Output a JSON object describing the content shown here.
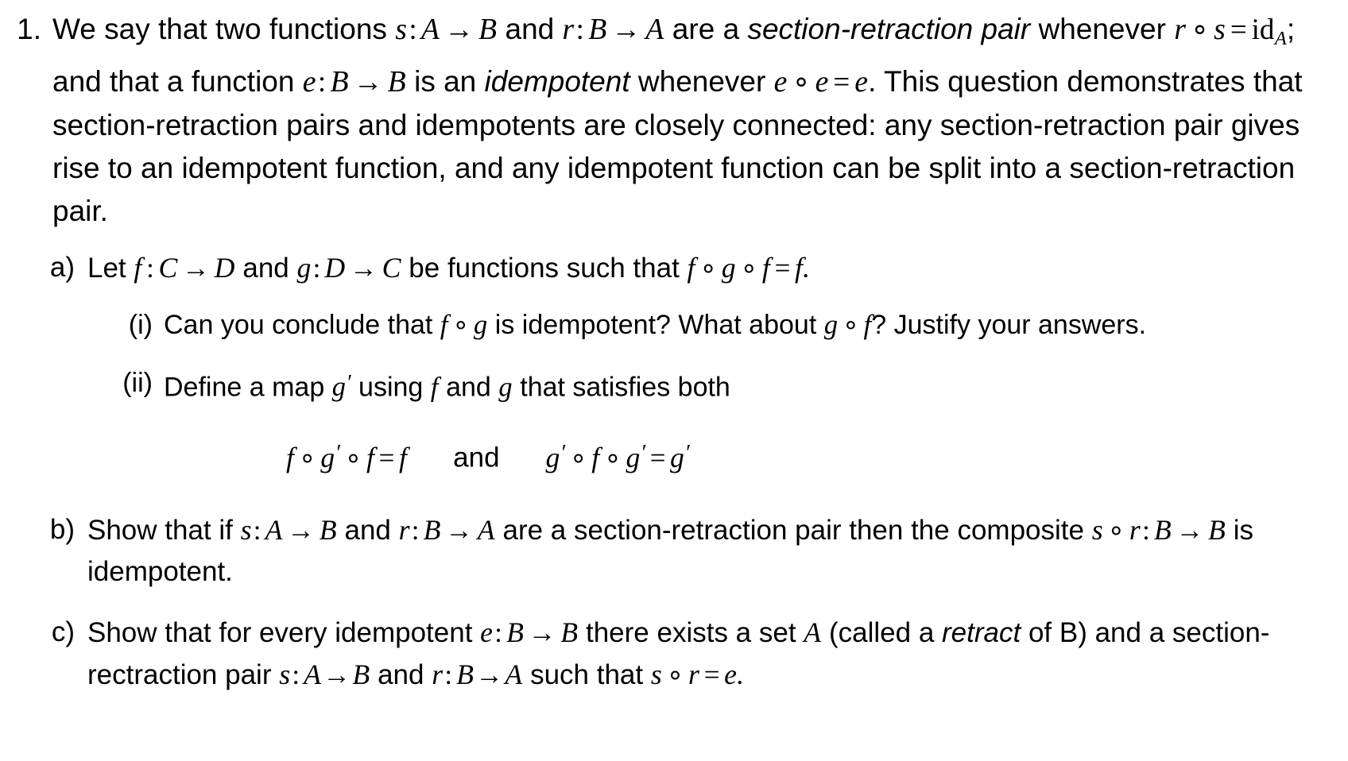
{
  "document": {
    "type": "math-exercise-sheet",
    "background_color": "#ffffff",
    "text_color": "#000000"
  },
  "question": {
    "marker": "1.",
    "intro": {
      "seg1": "We say that two functions ",
      "fn_s": "s",
      "colon1": ":",
      "set_A": "A",
      "arrow1": "→",
      "set_B": "B",
      "seg2": " and ",
      "fn_r": "r",
      "colon2": ":",
      "set_B2": "B",
      "arrow2": "→",
      "set_A2": "A",
      "seg3": " are a ",
      "emph1": "section-retraction pair",
      "seg4": " whenever ",
      "eq_r": "r",
      "circ1": "∘",
      "eq_s": "s",
      "equals1": "=",
      "id_text": "id",
      "id_sub": "A",
      "seg5": "; and that a function ",
      "fn_e": "e",
      "colon3": ":",
      "set_B3": "B",
      "arrow3": "→",
      "set_B4": "B",
      "seg6": " is an ",
      "emph2": "idempotent",
      "seg7": " whenever ",
      "eq_e1": "e",
      "circ2": "∘",
      "eq_e2": "e",
      "equals2": "=",
      "eq_e3": "e",
      "seg8": ". This question demonstrates that section-retraction pairs and idempotents are closely connected: any section-retraction pair gives rise to an idempotent function, and any idempotent function can be split into a section-retraction pair."
    }
  },
  "parts": {
    "a": {
      "marker": "a)",
      "lead": "Let ",
      "fn_f": "f",
      "colon1": ":",
      "set_C": "C",
      "arrow1": "→",
      "set_D": "D",
      "mid": " and ",
      "fn_g": "g",
      "colon2": ":",
      "set_D2": "D",
      "arrow2": "→",
      "set_C2": "C",
      "tail": " be functions such that ",
      "eq_f1": "f",
      "circ1": "∘",
      "eq_g": "g",
      "circ2": "∘",
      "eq_f2": "f",
      "equals": "=",
      "eq_f3": "f",
      "period": "."
    },
    "a_i": {
      "marker": "(i)",
      "seg1": "Can you conclude that ",
      "fg_f": "f",
      "fg_circ": "∘",
      "fg_g": "g",
      "seg2": " is idempotent? What about ",
      "gf_g": "g",
      "gf_circ": "∘",
      "gf_f": "f",
      "seg3": "? Justify your answers."
    },
    "a_ii": {
      "marker": "(ii)",
      "seg1": "Define a map ",
      "gprime": "g",
      "prime": "′",
      "seg2": " using ",
      "fn_f": "f",
      "seg3": " and ",
      "fn_g": "g",
      "seg4": " that satisfies both"
    },
    "a_ii_equation": {
      "left": {
        "t1": "f",
        "c1": "∘",
        "t2": "g",
        "p2": "′",
        "c2": "∘",
        "t3": "f",
        "eq": "=",
        "t4": "f"
      },
      "conjunction": "and",
      "right": {
        "t1": "g",
        "p1": "′",
        "c1": "∘",
        "t2": "f",
        "c2": "∘",
        "t3": "g",
        "p3": "′",
        "eq": "=",
        "t4": "g",
        "p4": "′"
      }
    },
    "b": {
      "marker": "b)",
      "seg1": "Show that if ",
      "fn_s": "s",
      "colon1": ":",
      "set_A": "A",
      "arrow1": "→",
      "set_B": "B",
      "seg2": " and ",
      "fn_r": "r",
      "colon2": ":",
      "set_B2": "B",
      "arrow2": "→",
      "set_A2": "A",
      "seg3": " are a section-retraction pair then the composite ",
      "comp_s": "s",
      "comp_circ": "∘",
      "comp_r": "r",
      "comp_colon": ":",
      "comp_B1": "B",
      "comp_arrow": "→",
      "comp_B2": "B",
      "seg4": " is idempotent."
    },
    "c": {
      "marker": "c)",
      "seg1": "Show that for every idempotent ",
      "fn_e": "e",
      "colon1": ":",
      "set_B": "B",
      "arrow1": "→",
      "set_B2": "B",
      "seg2": " there exists a set ",
      "set_A": "A",
      "seg3": " (called a ",
      "emph": "retract",
      "seg4": " of B) and a section-rectraction pair ",
      "fn_s": "s",
      "colon2": ":",
      "set_A2": "A",
      "arrow2": "→",
      "set_B3": "B",
      "seg5": " and ",
      "fn_r": "r",
      "colon3": ":",
      "set_B4": "B",
      "arrow3": "→",
      "set_A3": "A",
      "seg6": " such that ",
      "eq_s": "s",
      "eq_circ": "∘",
      "eq_r": "r",
      "equals": "=",
      "eq_e": "e",
      "period": "."
    }
  }
}
